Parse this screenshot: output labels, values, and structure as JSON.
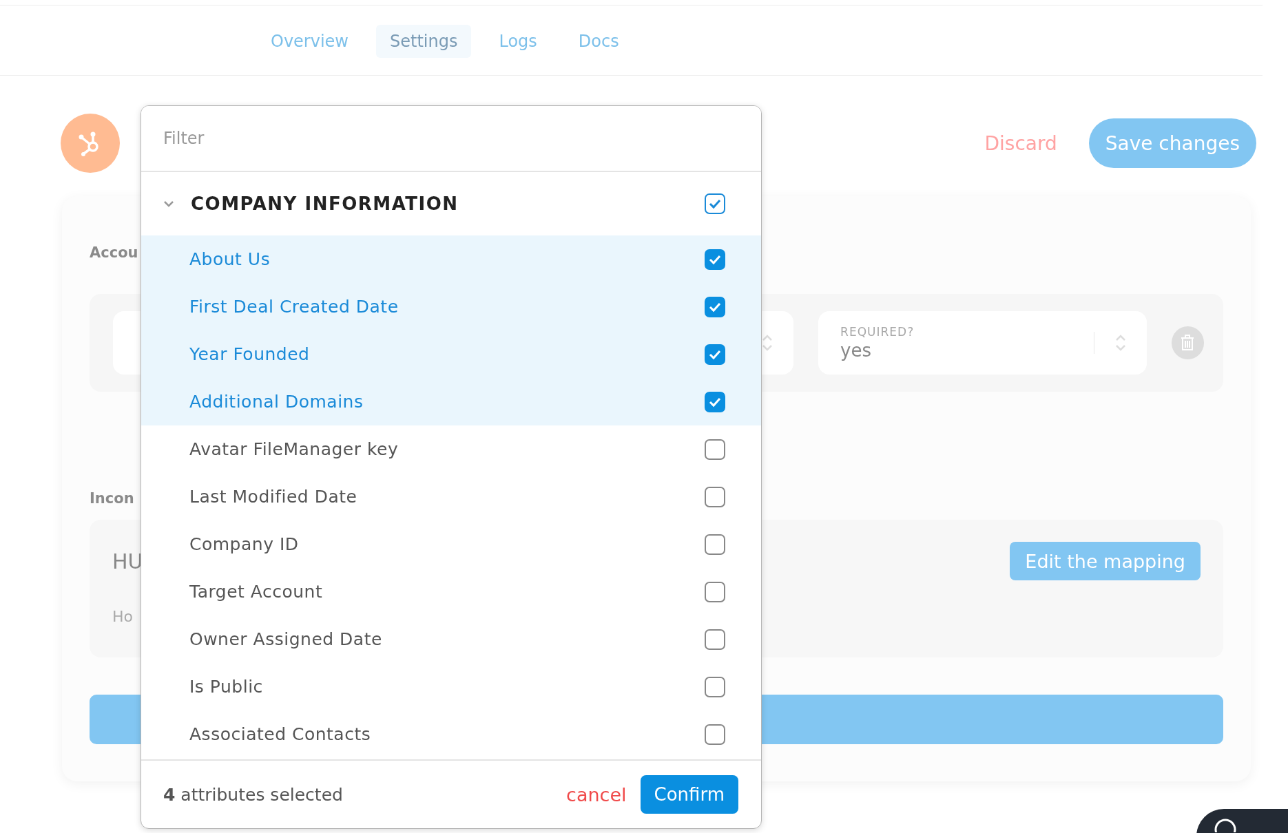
{
  "tabs": [
    {
      "label": "Overview",
      "selected": false
    },
    {
      "label": "Settings",
      "selected": true
    },
    {
      "label": "Logs",
      "selected": false
    },
    {
      "label": "Docs",
      "selected": false
    }
  ],
  "actions": {
    "discard": "Discard",
    "save": "Save changes"
  },
  "account_section": {
    "title": "Accou",
    "field_2": {
      "label": "REQUIRED?",
      "value": "yes"
    }
  },
  "income_section": {
    "title": "Incon",
    "heading": "HU",
    "hint": "Ho",
    "button": "Edit the mapping"
  },
  "popup": {
    "filter_placeholder": "Filter",
    "group": {
      "title": "COMPANY INFORMATION",
      "expanded": true,
      "checked": true,
      "items": [
        {
          "label": "About Us",
          "checked": true
        },
        {
          "label": "First Deal Created Date",
          "checked": true
        },
        {
          "label": "Year Founded",
          "checked": true
        },
        {
          "label": "Additional Domains",
          "checked": true
        },
        {
          "label": "Avatar FileManager key",
          "checked": false
        },
        {
          "label": "Last Modified Date",
          "checked": false
        },
        {
          "label": "Company ID",
          "checked": false
        },
        {
          "label": "Target Account",
          "checked": false
        },
        {
          "label": "Owner Assigned Date",
          "checked": false
        },
        {
          "label": "Is Public",
          "checked": false
        },
        {
          "label": "Associated Contacts",
          "checked": false
        }
      ]
    },
    "footer": {
      "summary": "**4** attributes selected",
      "cancel": "cancel",
      "confirm": "Confirm"
    }
  }
}
